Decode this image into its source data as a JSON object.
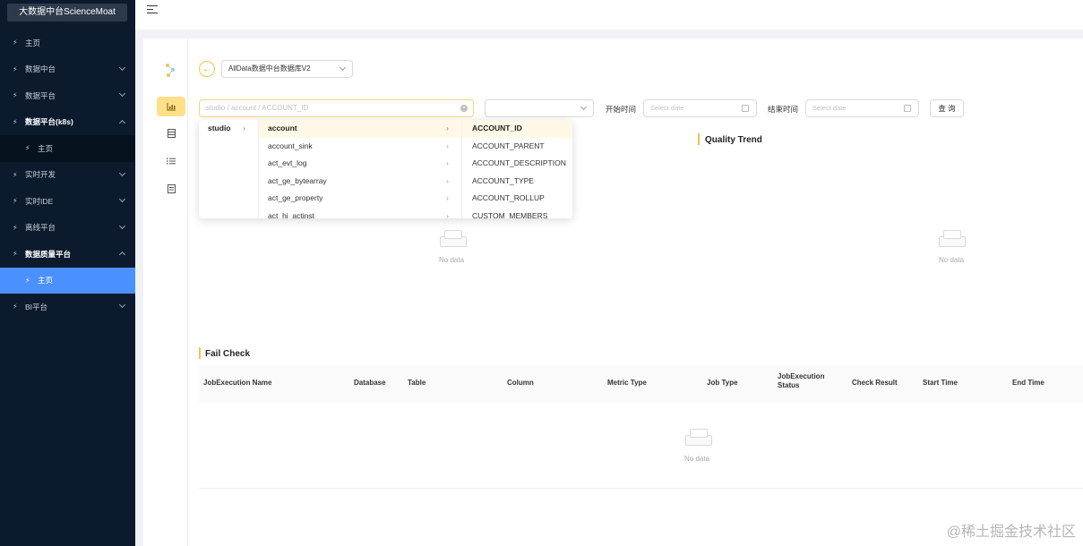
{
  "sidebar": {
    "brand": "大数据中台ScienceMoat",
    "items": [
      {
        "label": "主页"
      },
      {
        "label": "数据中台"
      },
      {
        "label": "数据平台"
      },
      {
        "label": "数据平台(k8s)"
      },
      {
        "label": "主页"
      },
      {
        "label": "实时开发"
      },
      {
        "label": "实时IDE"
      },
      {
        "label": "离线平台"
      },
      {
        "label": "数据质量平台"
      },
      {
        "label": "主页"
      },
      {
        "label": "BI平台"
      }
    ]
  },
  "toolbar": {
    "datasource": "AllData数据中台数据库V2",
    "cascader_placeholder": "studio / account / ACCOUNT_ID",
    "start_label": "开始时间",
    "end_label": "结束时间",
    "date_placeholder": "Select date",
    "query_label": "查 询"
  },
  "dropdown": {
    "col1": [
      "studio"
    ],
    "col2": [
      "account",
      "account_sink",
      "act_evt_log",
      "act_ge_bytearray",
      "act_ge_property",
      "act_hi_actinst"
    ],
    "col3": [
      "ACCOUNT_ID",
      "ACCOUNT_PARENT",
      "ACCOUNT_DESCRIPTION",
      "ACCOUNT_TYPE",
      "ACCOUNT_ROLLUP",
      "CUSTOM_MEMBERS"
    ]
  },
  "charts": {
    "quality_trend_title": "Quality Trend",
    "no_data": "No data"
  },
  "fail_check": {
    "title": "Fail Check",
    "columns": [
      "JobExecution Name",
      "Database",
      "Table",
      "Column",
      "Metric Type",
      "Job Type",
      "JobExecution Status",
      "Check Result",
      "Start Time",
      "End Time"
    ],
    "status_col_line1": "JobExecution",
    "status_col_line2": "Status",
    "no_data": "No data"
  },
  "watermark": "@稀土掘金技术社区",
  "colors": {
    "sidebar_bg": "#0b1a2c",
    "accent_blue": "#4a90ff",
    "accent_yellow": "#f2c14e"
  }
}
